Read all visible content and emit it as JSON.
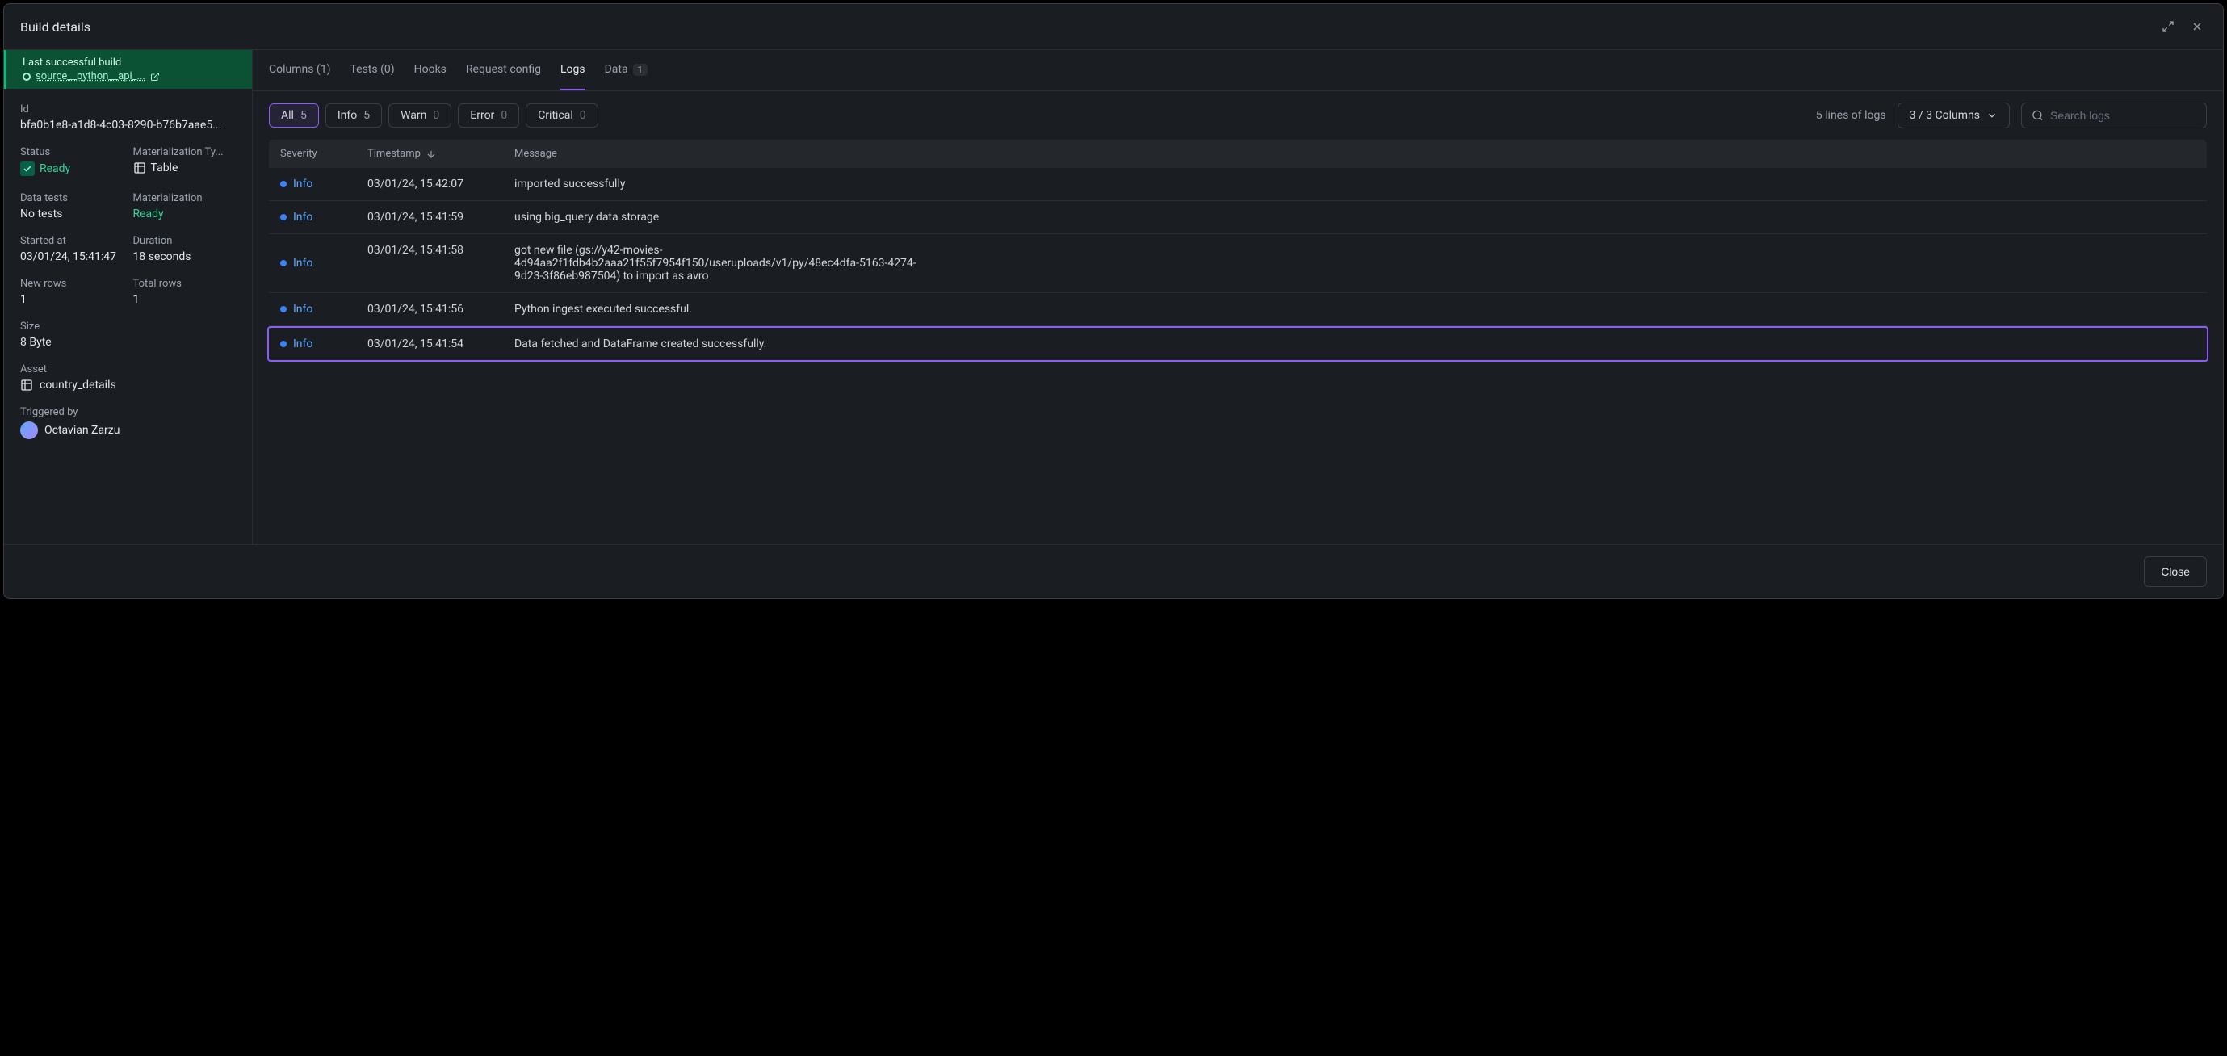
{
  "title": "Build details",
  "lastBuild": {
    "label": "Last successful build",
    "name": "source__python__api_..."
  },
  "fields": {
    "id": {
      "label": "Id",
      "value": "bfa0b1e8-a1d8-4c03-8290-b76b7aae5..."
    },
    "status": {
      "label": "Status",
      "value": "Ready"
    },
    "matType": {
      "label": "Materialization Ty...",
      "value": "Table"
    },
    "dataTests": {
      "label": "Data tests",
      "value": "No tests"
    },
    "materialization": {
      "label": "Materialization",
      "value": "Ready"
    },
    "startedAt": {
      "label": "Started at",
      "value": "03/01/24, 15:41:47"
    },
    "duration": {
      "label": "Duration",
      "value": "18 seconds"
    },
    "newRows": {
      "label": "New rows",
      "value": "1"
    },
    "totalRows": {
      "label": "Total rows",
      "value": "1"
    },
    "size": {
      "label": "Size",
      "value": "8 Byte"
    },
    "asset": {
      "label": "Asset",
      "value": "country_details"
    },
    "triggeredBy": {
      "label": "Triggered by",
      "value": "Octavian Zarzu"
    }
  },
  "tabs": {
    "columns": "Columns (1)",
    "tests": "Tests (0)",
    "hooks": "Hooks",
    "requestConfig": "Request config",
    "logs": "Logs",
    "data": "Data",
    "dataBadge": "1"
  },
  "filters": {
    "all": {
      "label": "All",
      "count": "5"
    },
    "info": {
      "label": "Info",
      "count": "5"
    },
    "warn": {
      "label": "Warn",
      "count": "0"
    },
    "error": {
      "label": "Error",
      "count": "0"
    },
    "critical": {
      "label": "Critical",
      "count": "0"
    }
  },
  "toolbar": {
    "linesText": "5 lines of logs",
    "columnsBtn": "3 / 3 Columns",
    "searchPlaceholder": "Search logs"
  },
  "columns": {
    "severity": "Severity",
    "timestamp": "Timestamp",
    "message": "Message"
  },
  "logs": [
    {
      "severity": "Info",
      "timestamp": "03/01/24, 15:42:07",
      "message": "imported successfully"
    },
    {
      "severity": "Info",
      "timestamp": "03/01/24, 15:41:59",
      "message": "using big_query data storage"
    },
    {
      "severity": "Info",
      "timestamp": "03/01/24, 15:41:58",
      "message": "got new file (gs://y42-movies-4d94aa2f1fdb4b2aaa21f55f7954f150/useruploads/v1/py/48ec4dfa-5163-4274-9d23-3f86eb987504) to import as avro"
    },
    {
      "severity": "Info",
      "timestamp": "03/01/24, 15:41:56",
      "message": "Python ingest executed successful."
    },
    {
      "severity": "Info",
      "timestamp": "03/01/24, 15:41:54",
      "message": "Data fetched and DataFrame created successfully."
    }
  ],
  "footer": {
    "close": "Close"
  }
}
